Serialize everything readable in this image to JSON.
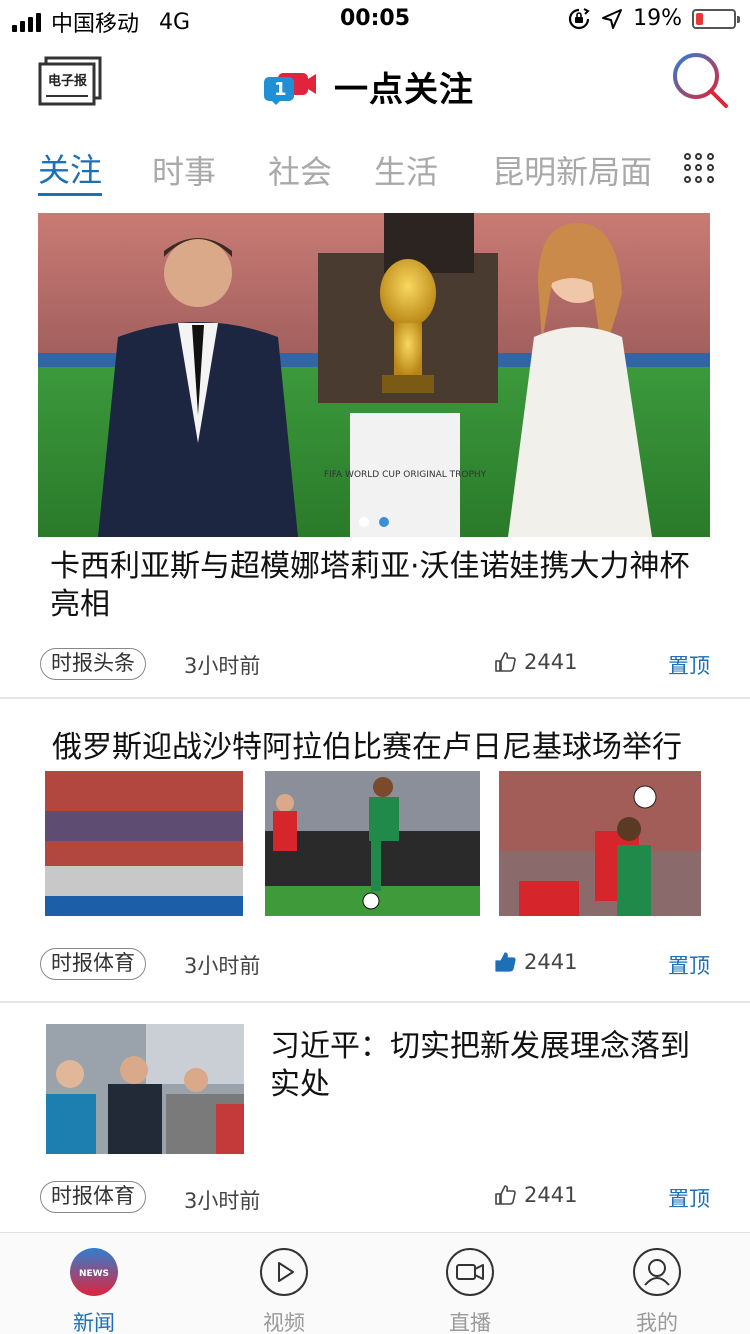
{
  "status_bar": {
    "carrier": "中国移动",
    "network": "4G",
    "time": "00:05",
    "battery": "19%",
    "battery_level": 0.19
  },
  "header": {
    "epaper_label": "电子报",
    "app_name": "一点关注",
    "logo_badge": "1"
  },
  "tabs": [
    "关注",
    "时事",
    "社会",
    "生活",
    "昆明新局面"
  ],
  "articles": [
    {
      "title": "卡西利亚斯与超模娜塔莉亚·沃佳诺娃携大力神杯亮相",
      "image_caption": "FIFA WORLD CUP ORIGINAL TROPHY",
      "source": "时报头条",
      "time": "3小时前",
      "likes": "2441",
      "pin": "置顶"
    },
    {
      "title": "俄罗斯迎战沙特阿拉伯比赛在卢日尼基球场举行",
      "source": "时报体育",
      "time": "3小时前",
      "likes": "2441",
      "pin": "置顶"
    },
    {
      "title": "习近平：切实把新发展理念落到实处",
      "source": "时报体育",
      "time": "3小时前",
      "likes": "2441",
      "pin": "置顶"
    }
  ],
  "bottom_nav": [
    {
      "label": "新闻",
      "badge": "NEWS"
    },
    {
      "label": "视频"
    },
    {
      "label": "直播"
    },
    {
      "label": "我的"
    }
  ],
  "colors": {
    "accent": "#1d6fb8",
    "brand_red": "#e0243c",
    "brand_blue": "#1f8fd6",
    "inactive": "#a9a9a9"
  }
}
